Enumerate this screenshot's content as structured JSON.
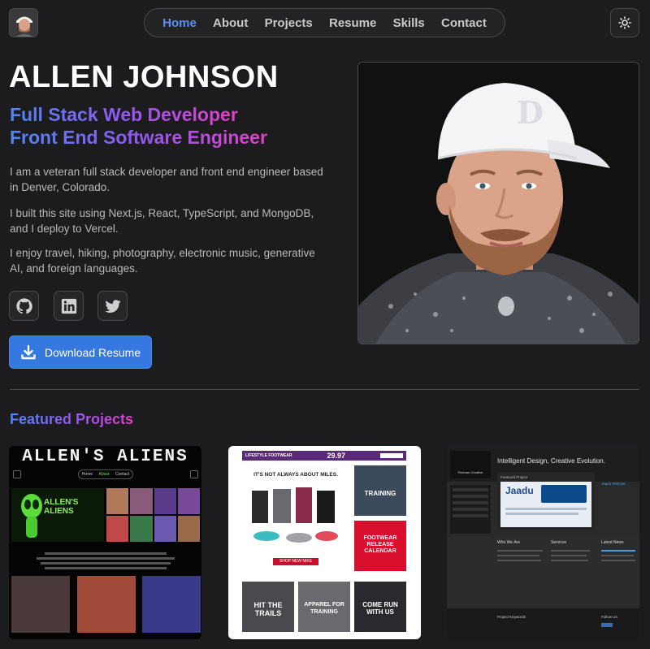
{
  "nav": {
    "items": [
      {
        "label": "Home",
        "active": true
      },
      {
        "label": "About",
        "active": false
      },
      {
        "label": "Projects",
        "active": false
      },
      {
        "label": "Resume",
        "active": false
      },
      {
        "label": "Skills",
        "active": false
      },
      {
        "label": "Contact",
        "active": false
      }
    ],
    "theme_icon": "sun-icon",
    "accent_color": "#5b8ff0"
  },
  "hero": {
    "name": "ALLEN JOHNSON",
    "subtitle_line1": "Full Stack Web Developer",
    "subtitle_line2": "Front End Software Engineer",
    "bio": [
      "I am a veteran full stack developer and front end engineer based in Denver, Colorado.",
      "I built this site using Next.js, React, TypeScript, and MongoDB, and I deploy to Vercel.",
      "I enjoy travel, hiking, photography, electronic music, generative AI, and foreign languages."
    ],
    "social_icons": [
      "github-icon",
      "linkedin-icon",
      "twitter-icon"
    ],
    "download_label": "Download Resume",
    "button_color": "#3478e0"
  },
  "featured": {
    "heading": "Featured Projects",
    "projects": [
      {
        "title": "ALLEN'S ALIENS",
        "nav": [
          "Home",
          "About",
          "Contact"
        ],
        "banner": "ALLEN'S ALIENS"
      },
      {
        "header": "LIFESTYLE FOOTWEAR",
        "price": "29.97",
        "headline": "IT'S NOT ALWAYS ABOUT MILES.",
        "tile_training": "TRAINING",
        "tile_release": "FOOTWEAR RELEASE CALENDAR",
        "shop_label": "SHOP NEW NIKE",
        "tile_trails": "HIT THE TRAILS",
        "tile_apparel": "APPAREL FOR TRAINING",
        "tile_run": "COME RUN WITH US"
      },
      {
        "brand": "Fireman Creative",
        "tagline": "Intelligent Design, Creative Evolution.",
        "featured_label": "Featured Project",
        "project_name": "Jaadu",
        "project_link": "Jaadu Website",
        "col_about": "Who We Are",
        "col_services": "Services",
        "col_news": "Latest News",
        "footer_keywords": "Project Keywords",
        "footer_follow": "Follow Us"
      }
    ]
  }
}
